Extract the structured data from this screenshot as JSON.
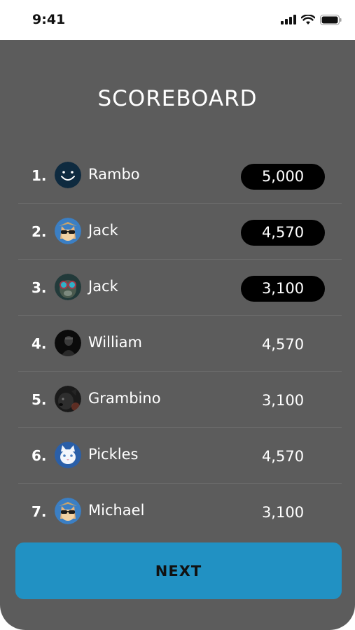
{
  "status_bar": {
    "time": "9:41",
    "icons": [
      "signal-icon",
      "wifi-icon",
      "battery-icon"
    ]
  },
  "title": "SCOREBOARD",
  "players": [
    {
      "rank": "1.",
      "name": "Rambo",
      "score": "5,000",
      "highlight": true,
      "avatar": "smiley-avatar"
    },
    {
      "rank": "2.",
      "name": "Jack",
      "score": "4,570",
      "highlight": true,
      "avatar": "cat-sunglasses-avatar"
    },
    {
      "rank": "3.",
      "name": "Jack",
      "score": "3,100",
      "highlight": true,
      "avatar": "monkey-goggles-avatar"
    },
    {
      "rank": "4.",
      "name": "William",
      "score": "4,570",
      "highlight": false,
      "avatar": "dark-figure-avatar"
    },
    {
      "rank": "5.",
      "name": "Grambino",
      "score": "3,100",
      "highlight": false,
      "avatar": "black-dog-avatar"
    },
    {
      "rank": "6.",
      "name": "Pickles",
      "score": "4,570",
      "highlight": false,
      "avatar": "white-cat-avatar"
    },
    {
      "rank": "7.",
      "name": "Michael",
      "score": "3,100",
      "highlight": false,
      "avatar": "cat-sunglasses-avatar"
    }
  ],
  "next_label": "NEXT",
  "colors": {
    "background": "#5c5c5c",
    "pill": "#000000",
    "button": "#2191c3"
  }
}
